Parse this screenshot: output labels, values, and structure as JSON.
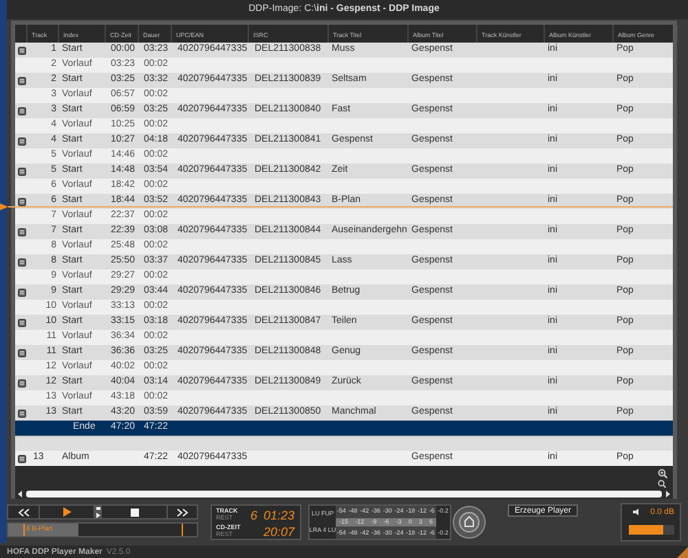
{
  "window": {
    "title": "DDP-Image: C:\\**ini - Gespenst - DDP Image**"
  },
  "table": {
    "columns": [
      "Track",
      "Index",
      "CD-Zeit",
      "Dauer",
      "UPC/EAN",
      "ISRC",
      "Track Titel",
      "Album Titel",
      "Track Künstler",
      "Album Künstler",
      "Album Genre"
    ],
    "rows": [
      {
        "kind": "start",
        "selected": false,
        "playhead": false,
        "track": "1",
        "index": "Start",
        "cd_time": "00:00",
        "duration": "03:23",
        "upc_ean": "4020796447335",
        "isrc": "DEL211300838",
        "track_title": "Muss",
        "album_title": "Gespenst",
        "album_artist": "ini",
        "album_genre": "Pop"
      },
      {
        "kind": "pregap",
        "selected": false,
        "playhead": false,
        "track": "2",
        "index": "Vorlauf",
        "cd_time": "03:23",
        "duration": "00:02"
      },
      {
        "kind": "start",
        "selected": false,
        "playhead": false,
        "track": "2",
        "index": "Start",
        "cd_time": "03:25",
        "duration": "03:32",
        "upc_ean": "4020796447335",
        "isrc": "DEL211300839",
        "track_title": "Seltsam",
        "album_title": "Gespenst",
        "album_artist": "ini",
        "album_genre": "Pop"
      },
      {
        "kind": "pregap",
        "selected": false,
        "playhead": false,
        "track": "3",
        "index": "Vorlauf",
        "cd_time": "06:57",
        "duration": "00:02"
      },
      {
        "kind": "start",
        "selected": false,
        "playhead": false,
        "track": "3",
        "index": "Start",
        "cd_time": "06:59",
        "duration": "03:25",
        "upc_ean": "4020796447335",
        "isrc": "DEL211300840",
        "track_title": "Fast",
        "album_title": "Gespenst",
        "album_artist": "ini",
        "album_genre": "Pop"
      },
      {
        "kind": "pregap",
        "selected": false,
        "playhead": false,
        "track": "4",
        "index": "Vorlauf",
        "cd_time": "10:25",
        "duration": "00:02"
      },
      {
        "kind": "start",
        "selected": false,
        "playhead": false,
        "track": "4",
        "index": "Start",
        "cd_time": "10:27",
        "duration": "04:18",
        "upc_ean": "4020796447335",
        "isrc": "DEL211300841",
        "track_title": "Gespenst",
        "album_title": "Gespenst",
        "album_artist": "ini",
        "album_genre": "Pop"
      },
      {
        "kind": "pregap",
        "selected": false,
        "playhead": false,
        "track": "5",
        "index": "Vorlauf",
        "cd_time": "14:46",
        "duration": "00:02"
      },
      {
        "kind": "start",
        "selected": false,
        "playhead": false,
        "track": "5",
        "index": "Start",
        "cd_time": "14:48",
        "duration": "03:54",
        "upc_ean": "4020796447335",
        "isrc": "DEL211300842",
        "track_title": "Zeit",
        "album_title": "Gespenst",
        "album_artist": "ini",
        "album_genre": "Pop"
      },
      {
        "kind": "pregap",
        "selected": false,
        "playhead": false,
        "track": "6",
        "index": "Vorlauf",
        "cd_time": "18:42",
        "duration": "00:02"
      },
      {
        "kind": "start",
        "selected": false,
        "playhead": true,
        "track": "6",
        "index": "Start",
        "cd_time": "18:44",
        "duration": "03:52",
        "upc_ean": "4020796447335",
        "isrc": "DEL211300843",
        "track_title": "B-Plan",
        "album_title": "Gespenst",
        "album_artist": "ini",
        "album_genre": "Pop"
      },
      {
        "kind": "pregap",
        "selected": false,
        "playhead": false,
        "track": "7",
        "index": "Vorlauf",
        "cd_time": "22:37",
        "duration": "00:02"
      },
      {
        "kind": "start",
        "selected": false,
        "playhead": false,
        "track": "7",
        "index": "Start",
        "cd_time": "22:39",
        "duration": "03:08",
        "upc_ean": "4020796447335",
        "isrc": "DEL211300844",
        "track_title": "Auseinandergehn",
        "album_title": "Gespenst",
        "album_artist": "ini",
        "album_genre": "Pop"
      },
      {
        "kind": "pregap",
        "selected": false,
        "playhead": false,
        "track": "8",
        "index": "Vorlauf",
        "cd_time": "25:48",
        "duration": "00:02"
      },
      {
        "kind": "start",
        "selected": false,
        "playhead": false,
        "track": "8",
        "index": "Start",
        "cd_time": "25:50",
        "duration": "03:37",
        "upc_ean": "4020796447335",
        "isrc": "DEL211300845",
        "track_title": "Lass",
        "album_title": "Gespenst",
        "album_artist": "ini",
        "album_genre": "Pop"
      },
      {
        "kind": "pregap",
        "selected": false,
        "playhead": false,
        "track": "9",
        "index": "Vorlauf",
        "cd_time": "29:27",
        "duration": "00:02"
      },
      {
        "kind": "start",
        "selected": false,
        "playhead": false,
        "track": "9",
        "index": "Start",
        "cd_time": "29:29",
        "duration": "03:44",
        "upc_ean": "4020796447335",
        "isrc": "DEL211300846",
        "track_title": "Betrug",
        "album_title": "Gespenst",
        "album_artist": "ini",
        "album_genre": "Pop"
      },
      {
        "kind": "pregap",
        "selected": false,
        "playhead": false,
        "track": "10",
        "index": "Vorlauf",
        "cd_time": "33:13",
        "duration": "00:02"
      },
      {
        "kind": "start",
        "selected": false,
        "playhead": false,
        "track": "10",
        "index": "Start",
        "cd_time": "33:15",
        "duration": "03:18",
        "upc_ean": "4020796447335",
        "isrc": "DEL211300847",
        "track_title": "Teilen",
        "album_title": "Gespenst",
        "album_artist": "ini",
        "album_genre": "Pop"
      },
      {
        "kind": "pregap",
        "selected": false,
        "playhead": false,
        "track": "11",
        "index": "Vorlauf",
        "cd_time": "36:34",
        "duration": "00:02"
      },
      {
        "kind": "start",
        "selected": false,
        "playhead": false,
        "track": "11",
        "index": "Start",
        "cd_time": "36:36",
        "duration": "03:25",
        "upc_ean": "4020796447335",
        "isrc": "DEL211300848",
        "track_title": "Genug",
        "album_title": "Gespenst",
        "album_artist": "ini",
        "album_genre": "Pop"
      },
      {
        "kind": "pregap",
        "selected": false,
        "playhead": false,
        "track": "12",
        "index": "Vorlauf",
        "cd_time": "40:02",
        "duration": "00:02"
      },
      {
        "kind": "start",
        "selected": false,
        "playhead": false,
        "track": "12",
        "index": "Start",
        "cd_time": "40:04",
        "duration": "03:14",
        "upc_ean": "4020796447335",
        "isrc": "DEL211300849",
        "track_title": "Zurück",
        "album_title": "Gespenst",
        "album_artist": "ini",
        "album_genre": "Pop"
      },
      {
        "kind": "pregap",
        "selected": false,
        "playhead": false,
        "track": "13",
        "index": "Vorlauf",
        "cd_time": "43:18",
        "duration": "00:02"
      },
      {
        "kind": "start",
        "selected": false,
        "playhead": false,
        "track": "13",
        "index": "Start",
        "cd_time": "43:20",
        "duration": "03:59",
        "upc_ean": "4020796447335",
        "isrc": "DEL211300850",
        "track_title": "Manchmal",
        "album_title": "Gespenst",
        "album_artist": "ini",
        "album_genre": "Pop"
      },
      {
        "kind": "end",
        "selected": true,
        "playhead": false,
        "index": "Ende",
        "cd_time": "47:20",
        "duration": "47:22"
      }
    ],
    "album_row": {
      "track": "13",
      "index": "Album",
      "duration": "47:22",
      "upc_ean": "4020796447335",
      "album_title": "Gespenst",
      "album_artist": "ini",
      "album_genre": "Pop"
    }
  },
  "timeline": {
    "marker_label": "6 B-Plan",
    "level": 0.37
  },
  "display": {
    "track_label": "TRACK",
    "track_sub": "REST",
    "track_number": "6",
    "track_time": "01:23",
    "cd_label": "CD-ZEIT",
    "cd_sub": "REST",
    "cd_time": "20:07"
  },
  "meters": {
    "row_labels": [
      "LU FUP",
      "LRA 4 LU"
    ],
    "top_scale": [
      "-54",
      "-48",
      "-42",
      "-36",
      "-30",
      "-24",
      "-18",
      "-12",
      "-6"
    ],
    "mid_scale": [
      "-15",
      "-12",
      "-9",
      "-6",
      "-3",
      "0",
      "3",
      "6"
    ],
    "bottom_scale": [
      "-54",
      "-48",
      "-42",
      "-36",
      "-30",
      "-24",
      "-18",
      "-12",
      "-6"
    ],
    "peaks": [
      "-0.2",
      "-0.2"
    ]
  },
  "create_button": "Erzeuge Player",
  "volume": {
    "reading": "0.0 dB",
    "level": 0.75
  },
  "status_bar": {
    "app": "HOFA DDP Player Maker",
    "version": "V2.5.0"
  }
}
